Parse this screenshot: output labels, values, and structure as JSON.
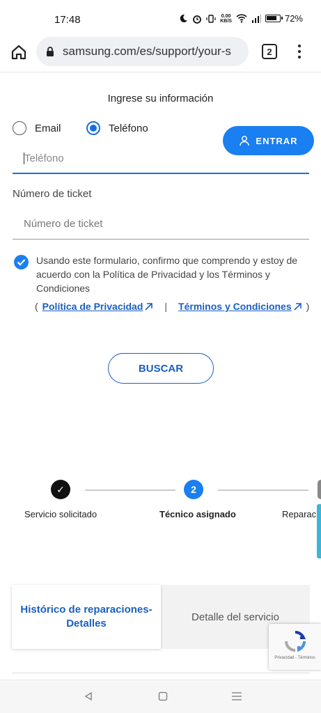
{
  "status_bar": {
    "time": "17:48",
    "net_speed": "0.00",
    "net_unit": "KB/S",
    "battery": "72%"
  },
  "browser": {
    "url": "samsung.com/es/support/your-s",
    "tab_count": "2"
  },
  "form": {
    "title": "Ingrese su información",
    "radio_email": "Email",
    "radio_phone": "Teléfono",
    "selected": "Teléfono",
    "login_button": "ENTRAR",
    "phone_placeholder": "Teléfono",
    "ticket_label": "Número de ticket",
    "ticket_placeholder": "Número de ticket",
    "consent_text": "Usando este formulario, confirmo que comprendo y estoy de acuerdo con la Política de Privacidad y los Términos y Condiciones",
    "consent_checked": true,
    "link_open": "(",
    "privacy_link": "Política de Privacidad",
    "link_sep": "|",
    "terms_link": "Términos y Condiciones",
    "link_close": ")",
    "search_button": "BUSCAR"
  },
  "stepper": {
    "steps": [
      {
        "label": "Servicio solicitado",
        "state": "done",
        "marker": "✓"
      },
      {
        "label": "Técnico asignado",
        "state": "current",
        "marker": "2"
      },
      {
        "label": "Reparaci",
        "state": "pending",
        "marker": ""
      }
    ]
  },
  "panel_tabs": {
    "active": "Histórico de reparaciones- Detalles",
    "inactive": "Detalle del servicio"
  },
  "recaptcha": {
    "text": "Privacidad - Términos"
  },
  "colors": {
    "accent": "#1a7ff0",
    "link": "#1a5fc0",
    "step_done": "#111111"
  }
}
